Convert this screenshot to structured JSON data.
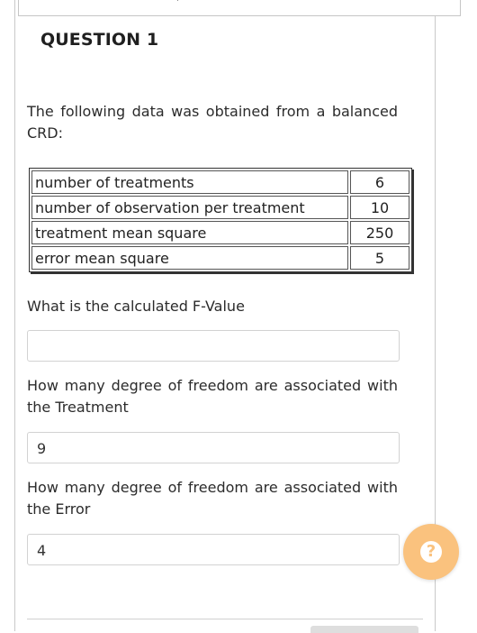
{
  "question": {
    "title": "QUESTION 1",
    "intro": "The following data was obtained from a balanced CRD:"
  },
  "data_table": {
    "rows": [
      {
        "label": "number of treatments",
        "value": "6"
      },
      {
        "label": "number of observation per treatment",
        "value": "10"
      },
      {
        "label": "treatment mean square",
        "value": "250"
      },
      {
        "label": "error mean square",
        "value": "5"
      }
    ]
  },
  "parts": [
    {
      "prompt": "What is the calculated F-Value",
      "answer": ""
    },
    {
      "prompt": "How many degree of freedom are associated with the Treatment",
      "answer": "9"
    },
    {
      "prompt": "How many degree of freedom are associated with the Error",
      "answer": "4"
    }
  ],
  "help": {
    "icon": "question-icon",
    "glyph": "?",
    "color": "#fac27e"
  }
}
